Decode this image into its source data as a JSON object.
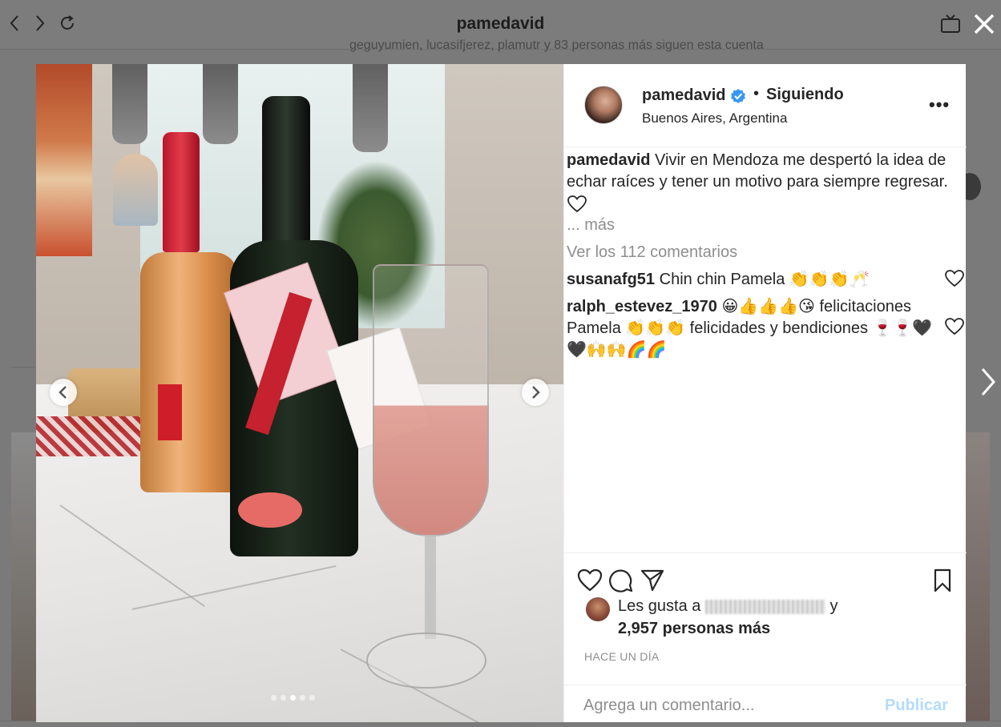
{
  "browser": {
    "title": "pamedavid",
    "back_icon": "chevron-left-icon",
    "forward_icon": "chevron-right-icon",
    "reload_icon": "reload-icon",
    "tv_icon": "tv-icon",
    "close_icon": "close-icon"
  },
  "background": {
    "followers_text": "geguyumien, lucasifjerez, plamutr y 83 personas más siguen esta cuenta"
  },
  "post": {
    "username": "pamedavid",
    "verified": true,
    "separator": "•",
    "follow_state": "Siguiendo",
    "location": "Buenos Aires, Argentina",
    "more_icon": "•••",
    "caption_user": "pamedavid",
    "caption_text": "Vivir en Mendoza me despertó la idea de echar raíces y tener un motivo para siempre regresar.",
    "more_label": "... más",
    "view_comments": "Ver los 112 comentarios",
    "carousel": {
      "count": 5,
      "active_index": 2
    },
    "comments": [
      {
        "user": "susanafg51",
        "text": "Chin chin Pamela 👏👏👏🥂"
      },
      {
        "user": "ralph_estevez_1970",
        "text": "😀👍👍👍😘 felicitaciones Pamela 👏👏👏 felicidades y bendiciones 🍷🍷🖤🖤🙌🙌🌈🌈"
      }
    ],
    "likes_prefix": "Les gusta a",
    "likes_suffix": "y",
    "likes_count": "2,957 personas más",
    "timestamp": "HACE UN DÍA",
    "comment_placeholder": "Agrega un comentario...",
    "publish_label": "Publicar"
  },
  "colors": {
    "verified": "#3897f0",
    "publish": "#b3dbff",
    "muted": "#8e8e8e",
    "text": "#262626"
  }
}
